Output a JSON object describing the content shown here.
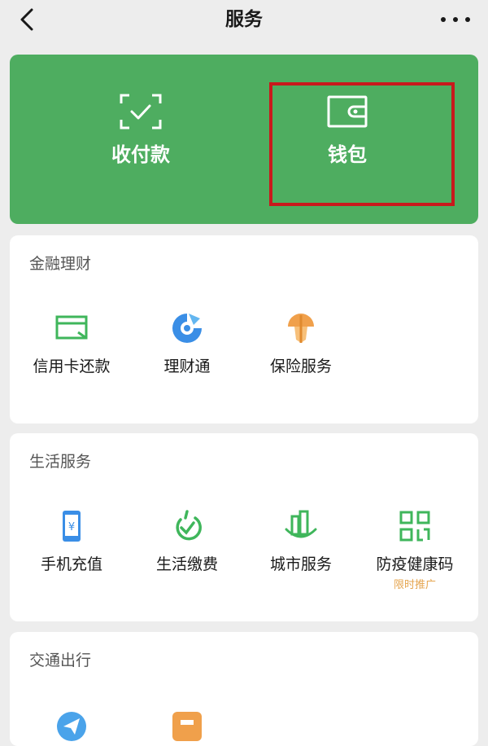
{
  "nav": {
    "title": "服务",
    "back_icon": "chevron-left-icon",
    "more_icon": "more-dots-icon"
  },
  "hero": {
    "items": [
      {
        "label": "收付款",
        "icon": "scan-check-icon"
      },
      {
        "label": "钱包",
        "icon": "wallet-icon"
      }
    ]
  },
  "finance": {
    "title": "金融理财",
    "items": [
      {
        "label": "信用卡还款",
        "icon": "credit-card-icon"
      },
      {
        "label": "理财通",
        "icon": "wealth-icon"
      },
      {
        "label": "保险服务",
        "icon": "umbrella-shield-icon"
      }
    ]
  },
  "life": {
    "title": "生活服务",
    "items": [
      {
        "label": "手机充值",
        "icon": "phone-recharge-icon"
      },
      {
        "label": "生活缴费",
        "icon": "utility-payment-icon"
      },
      {
        "label": "城市服务",
        "icon": "city-service-icon"
      },
      {
        "label": "防疫健康码",
        "icon": "qr-health-code-icon",
        "badge": "限时推广"
      }
    ]
  },
  "transport": {
    "title": "交通出行",
    "items": [
      {
        "label": "",
        "icon": "paper-plane-icon"
      },
      {
        "label": "",
        "icon": "train-ticket-icon"
      }
    ]
  },
  "colors": {
    "brand_green": "#4ead60",
    "highlight_red": "#c9191c",
    "promo_orange": "#e5a54f"
  }
}
